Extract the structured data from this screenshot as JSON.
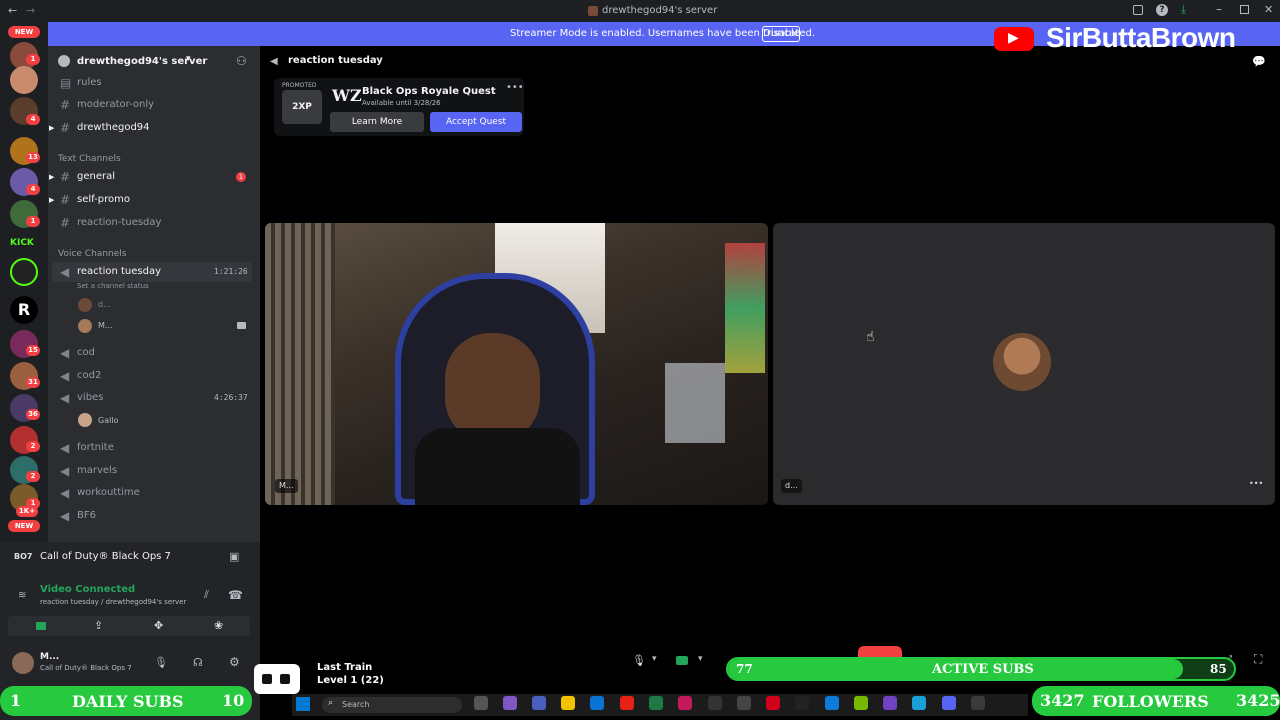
{
  "window": {
    "title": "drewthegod94's server"
  },
  "banner": {
    "text": "Streamer Mode is enabled. Usernames have been truncated.",
    "disable_label": "Disable"
  },
  "servers": {
    "new_top": "NEW",
    "new_bottom": "NEW",
    "badges": [
      "1",
      "4",
      "13",
      "4",
      "1",
      "15",
      "31",
      "36",
      "2",
      "2",
      "1",
      "1K+",
      "2"
    ]
  },
  "sidebar": {
    "server_name": "drewthegod94's server",
    "top_channels": [
      "rules",
      "moderator-only",
      "drewthegod94"
    ],
    "text_category": "Text Channels",
    "text_channels": [
      {
        "name": "general",
        "badge": "1"
      },
      {
        "name": "self-promo"
      },
      {
        "name": "reaction-tuesday"
      }
    ],
    "voice_category": "Voice Channels",
    "active_voice": {
      "name": "reaction tuesday",
      "timer": "1:21:26",
      "status": "Set a channel status",
      "users": [
        "d...",
        "M..."
      ]
    },
    "voice_channels": [
      {
        "name": "cod"
      },
      {
        "name": "cod2"
      },
      {
        "name": "vibes",
        "timer": "4:26:37",
        "users": [
          "Gallo"
        ]
      },
      {
        "name": "fortnite"
      },
      {
        "name": "marvels"
      },
      {
        "name": "workouttime"
      },
      {
        "name": "BF6"
      }
    ]
  },
  "voice_panel": {
    "game": "Call of Duty® Black Ops 7",
    "status": "Video Connected",
    "location": "reaction tuesday / drewthegod94's server",
    "user_name": "M...",
    "user_activity": "Call of Duty® Black Ops 7"
  },
  "main": {
    "channel_title": "reaction tuesday",
    "quest": {
      "promoted": "PROMOTED",
      "xp": "2XP",
      "logo": "WZ",
      "title": "Black Ops Royale Quest",
      "subtitle": "Available until 3/28/26",
      "learn_more": "Learn More",
      "accept": "Accept Quest"
    },
    "tiles": [
      {
        "label": "M..."
      },
      {
        "label": "d..."
      }
    ]
  },
  "overlay": {
    "channel": "SirButtaBrown",
    "active_subs": {
      "label": "ACTIVE SUBS",
      "left": "77",
      "right": "85",
      "progress": 0.9
    },
    "daily_subs": {
      "label": "DAILY SUBS",
      "left": "1",
      "right": "10"
    },
    "followers": {
      "label": "FOLLOWERS",
      "left": "3427",
      "right": "3425"
    },
    "music": {
      "title": "Last Train",
      "level": "Level 1 (22)"
    }
  },
  "taskbar": {
    "search": "Search"
  },
  "colors": {
    "blurple": "#5865f2",
    "green": "#23a55a",
    "red": "#f23f42",
    "bar_green": "#27c93f"
  }
}
